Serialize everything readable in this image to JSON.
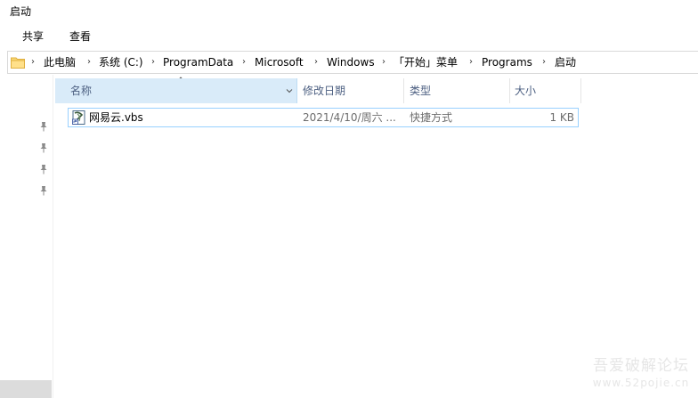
{
  "window": {
    "title": "启动"
  },
  "ribbon": {
    "tabs": [
      {
        "label": "共享"
      },
      {
        "label": "查看"
      }
    ]
  },
  "address_bar": {
    "breadcrumbs": [
      {
        "label": "此电脑"
      },
      {
        "label": "系统 (C:)"
      },
      {
        "label": "ProgramData"
      },
      {
        "label": "Microsoft"
      },
      {
        "label": "Windows"
      },
      {
        "label": "「开始」菜单"
      },
      {
        "label": "Programs"
      },
      {
        "label": "启动"
      }
    ],
    "separator_icon": "chevron-right-icon",
    "folder_icon": "folder-icon"
  },
  "nav_pane": {
    "pin_icon": "pin-icon",
    "pins": 4
  },
  "columns": {
    "name": "名称",
    "date_modified": "修改日期",
    "type": "类型",
    "size": "大小"
  },
  "files": [
    {
      "name": "网易云.vbs",
      "date_modified": "2021/4/10/周六 ...",
      "type": "快捷方式",
      "size": "1 KB",
      "icon": "vbs-shortcut-icon"
    }
  ],
  "watermark": {
    "line1": "吾爱破解论坛",
    "line2": "www.52pojie.cn"
  },
  "colors": {
    "selected_header_bg": "#d9ebf9",
    "row_border": "#99d1ff",
    "header_text": "#4d6082",
    "secondary_text": "#6d6d6d"
  }
}
